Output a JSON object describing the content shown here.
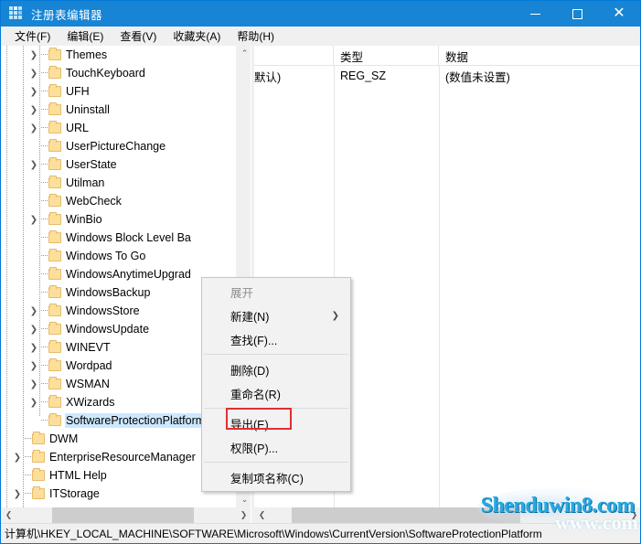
{
  "window": {
    "title": "注册表编辑器",
    "icon": "registry-icon",
    "controls": {
      "minimize": "—",
      "maximize": "▢",
      "close": "✕"
    }
  },
  "menubar": {
    "items": [
      {
        "label": "文件(F)",
        "name": "menu-file"
      },
      {
        "label": "编辑(E)",
        "name": "menu-edit"
      },
      {
        "label": "查看(V)",
        "name": "menu-view"
      },
      {
        "label": "收藏夹(A)",
        "name": "menu-favorites"
      },
      {
        "label": "帮助(H)",
        "name": "menu-help"
      }
    ]
  },
  "tree": {
    "items": [
      {
        "label": "Themes",
        "expandable": true,
        "depth": 1,
        "selected": false
      },
      {
        "label": "TouchKeyboard",
        "expandable": true,
        "depth": 1,
        "selected": false
      },
      {
        "label": "UFH",
        "expandable": true,
        "depth": 1,
        "selected": false
      },
      {
        "label": "Uninstall",
        "expandable": true,
        "depth": 1,
        "selected": false
      },
      {
        "label": "URL",
        "expandable": true,
        "depth": 1,
        "selected": false
      },
      {
        "label": "UserPictureChange",
        "expandable": false,
        "depth": 1,
        "selected": false
      },
      {
        "label": "UserState",
        "expandable": true,
        "depth": 1,
        "selected": false
      },
      {
        "label": "Utilman",
        "expandable": false,
        "depth": 1,
        "selected": false
      },
      {
        "label": "WebCheck",
        "expandable": false,
        "depth": 1,
        "selected": false
      },
      {
        "label": "WinBio",
        "expandable": true,
        "depth": 1,
        "selected": false
      },
      {
        "label": "Windows Block Level Ba",
        "expandable": false,
        "depth": 1,
        "selected": false
      },
      {
        "label": "Windows To Go",
        "expandable": false,
        "depth": 1,
        "selected": false
      },
      {
        "label": "WindowsAnytimeUpgrad",
        "expandable": false,
        "depth": 1,
        "selected": false
      },
      {
        "label": "WindowsBackup",
        "expandable": false,
        "depth": 1,
        "selected": false
      },
      {
        "label": "WindowsStore",
        "expandable": true,
        "depth": 1,
        "selected": false
      },
      {
        "label": "WindowsUpdate",
        "expandable": true,
        "depth": 1,
        "selected": false
      },
      {
        "label": "WINEVT",
        "expandable": true,
        "depth": 1,
        "selected": false
      },
      {
        "label": "Wordpad",
        "expandable": true,
        "depth": 1,
        "selected": false
      },
      {
        "label": "WSMAN",
        "expandable": true,
        "depth": 1,
        "selected": false
      },
      {
        "label": "XWizards",
        "expandable": true,
        "depth": 1,
        "selected": false
      },
      {
        "label": "SoftwareProtectionPlatform",
        "expandable": false,
        "depth": 1,
        "selected": true
      },
      {
        "label": "DWM",
        "expandable": false,
        "depth": 0,
        "selected": false
      },
      {
        "label": "EnterpriseResourceManager",
        "expandable": true,
        "depth": 0,
        "selected": false
      },
      {
        "label": "HTML Help",
        "expandable": false,
        "depth": 0,
        "selected": false
      },
      {
        "label": "ITStorage",
        "expandable": true,
        "depth": 0,
        "selected": false
      }
    ],
    "scrollbar": {
      "up_arrow": "⌃",
      "down_arrow": "⌄",
      "left_arrow": "❮",
      "right_arrow": "❯"
    }
  },
  "values": {
    "columns": [
      {
        "label": "",
        "name": "column-name"
      },
      {
        "label": "类型",
        "name": "column-type"
      },
      {
        "label": "数据",
        "name": "column-data"
      }
    ],
    "rows": [
      {
        "name": "默认)",
        "type": "REG_SZ",
        "data": "(数值未设置)"
      }
    ],
    "scrollbar": {
      "left_arrow": "❮",
      "right_arrow": "❯"
    }
  },
  "context_menu": {
    "items": [
      {
        "label": "展开",
        "name": "ctx-expand",
        "disabled": true,
        "submenu": false,
        "sep_after": false
      },
      {
        "label": "新建(N)",
        "name": "ctx-new",
        "disabled": false,
        "submenu": true,
        "sep_after": false
      },
      {
        "label": "查找(F)...",
        "name": "ctx-find",
        "disabled": false,
        "submenu": false,
        "sep_after": true
      },
      {
        "label": "删除(D)",
        "name": "ctx-delete",
        "disabled": false,
        "submenu": false,
        "sep_after": false
      },
      {
        "label": "重命名(R)",
        "name": "ctx-rename",
        "disabled": false,
        "submenu": false,
        "sep_after": true
      },
      {
        "label": "导出(E)",
        "name": "ctx-export",
        "disabled": false,
        "submenu": false,
        "sep_after": false
      },
      {
        "label": "权限(P)...",
        "name": "ctx-permissions",
        "disabled": false,
        "submenu": false,
        "sep_after": true,
        "highlighted": true
      },
      {
        "label": "复制项名称(C)",
        "name": "ctx-copy-key-name",
        "disabled": false,
        "submenu": false,
        "sep_after": false
      }
    ],
    "submenu_arrow": "❯",
    "highlight_color": "#e03030"
  },
  "statusbar": {
    "path": "计算机\\HKEY_LOCAL_MACHINE\\SOFTWARE\\Microsoft\\Windows\\CurrentVersion\\SoftwareProtectionPlatform"
  },
  "watermark": {
    "main": "Shenduwin8.com",
    "sub": "www.com",
    "color": "#29a8e0"
  }
}
